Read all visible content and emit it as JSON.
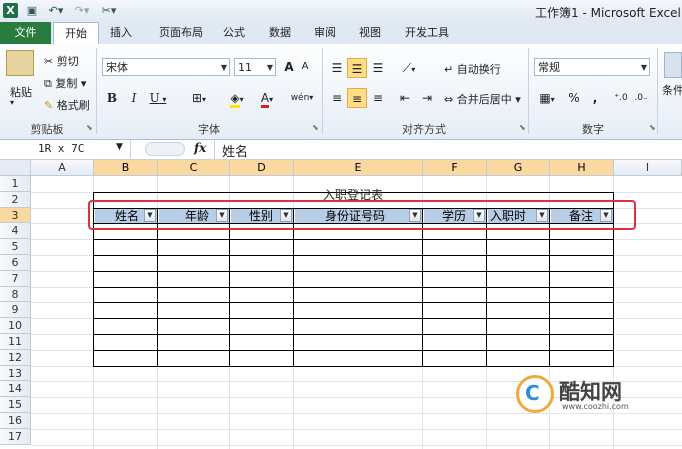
{
  "window": {
    "title": "工作簿1 - Microsoft Excel",
    "app_icon": "X"
  },
  "qat": {
    "save_icon": "save-icon",
    "undo_icon": "undo-icon",
    "redo_icon": "redo-icon"
  },
  "tabs": [
    "文件",
    "开始",
    "插入",
    "页面布局",
    "公式",
    "数据",
    "审阅",
    "视图",
    "开发工具"
  ],
  "ribbon": {
    "clipboard": {
      "paste": "粘贴",
      "cut": "剪切",
      "copy": "复制",
      "format_painter": "格式刷",
      "label": "剪贴板"
    },
    "font": {
      "name": "宋体",
      "size": "11",
      "grow": "A",
      "shrink": "A",
      "bold": "B",
      "italic": "I",
      "underline": "U",
      "fill": "A",
      "color": "A",
      "wen": "wén",
      "label": "字体"
    },
    "alignment": {
      "wrap": "自动换行",
      "merge": "合并后居中",
      "label": "对齐方式"
    },
    "number": {
      "format": "常规",
      "percent": "%",
      "comma": ",",
      "label": "数字"
    },
    "styles": {
      "partial": "条件"
    }
  },
  "formula_bar": {
    "name_box": "1R x 7C",
    "fx": "fx",
    "value": "姓名"
  },
  "sheet": {
    "columns": [
      "A",
      "B",
      "C",
      "D",
      "E",
      "F",
      "G",
      "H",
      "I"
    ],
    "rows": [
      "1",
      "2",
      "3",
      "4",
      "5",
      "6",
      "7",
      "8",
      "9",
      "10",
      "11",
      "12",
      "13",
      "14",
      "15",
      "16",
      "17"
    ],
    "table_title": "入职登记表",
    "headers": [
      "姓名",
      "年龄",
      "性别",
      "身份证号码",
      "学历",
      "入职时",
      "备注"
    ],
    "selected_columns": [
      "B",
      "C",
      "D",
      "E",
      "F",
      "G",
      "H"
    ],
    "selected_row": "3"
  },
  "watermark": {
    "brand": "酷知网",
    "url": "www.coozhi.com",
    "colors": {
      "orange": "#f2a83b",
      "blue": "#2d8fd5"
    }
  }
}
